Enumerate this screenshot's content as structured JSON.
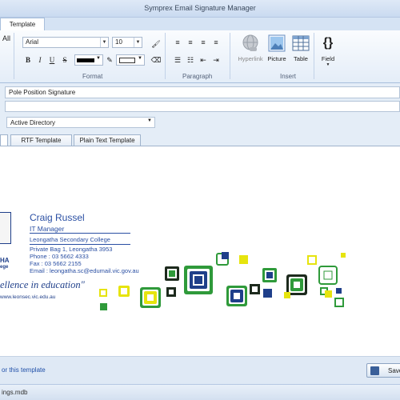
{
  "window": {
    "title": "Symprex Email Signature Manager"
  },
  "ribbon": {
    "tab_label": "Template",
    "left_cut_label": "All",
    "font_name": "Arial",
    "font_size": "10",
    "groups": {
      "format": "Format",
      "paragraph": "Paragraph",
      "insert": "Insert"
    },
    "insert_buttons": {
      "hyperlink": "Hyperlink",
      "picture": "Picture",
      "table": "Table",
      "field": "Field"
    },
    "field_glyph": "{}"
  },
  "editor": {
    "template_name": "Pole Position Signature",
    "second_field": "",
    "source_select": "Active Directory",
    "tabs": [
      "RTF Template",
      "Plain Text Template"
    ]
  },
  "signature": {
    "name": "Craig Russel",
    "position": "IT Manager",
    "company": "Leongatha Secondary College",
    "address": "Private Bag 1, Leongatha 3953",
    "phone": "Phone : 03 5662 4333",
    "fax": "Fax : 03 5662 2155",
    "email": "Email : leongatha.sc@edumail.vic.gov.au",
    "motto": "ellence in education\"",
    "website": "www.leonsec.vic.edu.au",
    "logo_text_1": "HA",
    "logo_text_2": "ege",
    "colors": {
      "green": "#2f9a3a",
      "navy": "#1f3f8a",
      "yellow": "#e6e40e",
      "dark": "#1d2a1d",
      "name_blue": "#2a4fa3"
    }
  },
  "footer": {
    "link_text": "or this template",
    "save_label": "Save"
  },
  "status": {
    "file": "ings.mdb"
  }
}
